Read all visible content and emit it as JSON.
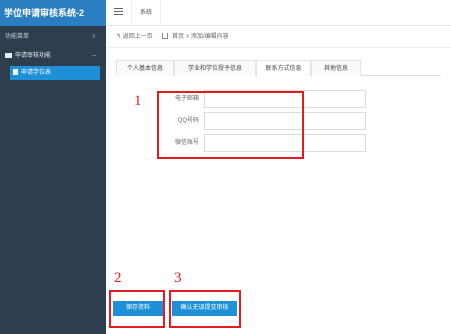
{
  "sidebar": {
    "title": "学位申请审核系统-2",
    "group_label": "功能菜单",
    "sub_label": "申请审核功能",
    "item_label": "申请学位表"
  },
  "topbar": {
    "tab_label": "系统"
  },
  "breadcrumb": {
    "back_label": "返回上一页",
    "path": "首页 > 添加/编辑内容"
  },
  "tabs": [
    {
      "label": "个人基本信息"
    },
    {
      "label": "学业和学位授予信息"
    },
    {
      "label": "联系方式信息"
    },
    {
      "label": "其他信息"
    }
  ],
  "form": {
    "fields": [
      {
        "label": "电子邮箱",
        "value": ""
      },
      {
        "label": "QQ号码",
        "value": ""
      },
      {
        "label": "微信账号",
        "value": ""
      }
    ]
  },
  "buttons": {
    "save_label": "保存资料",
    "submit_label": "确认无误提交审核"
  },
  "annotations": {
    "n1": "1",
    "n2": "2",
    "n3": "3"
  },
  "colors": {
    "accent": "#1e90d8",
    "sidebar_bg": "#2f3e4f",
    "header_bg": "#2a7fc3",
    "annotation": "#e31b23"
  }
}
